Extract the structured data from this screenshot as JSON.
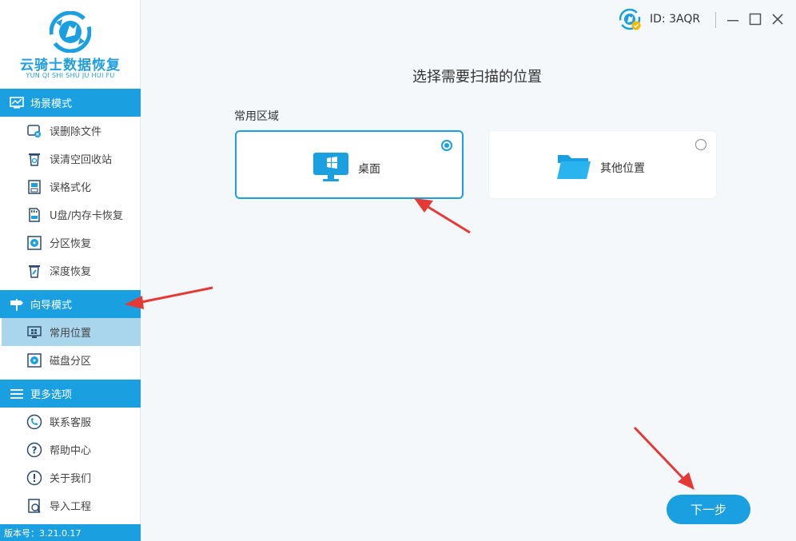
{
  "app": {
    "title": "云骑士数据恢复",
    "subtitle": "YUN QI SHI SHU JU HUI FU",
    "version": "版本号：3.21.0.17",
    "accent": "#1aa0e0"
  },
  "sidebar": {
    "sections": [
      {
        "label": "场景模式",
        "icon": "monitor-chart-icon",
        "items": [
          {
            "label": "误删除文件",
            "icon": "deleted-file-icon"
          },
          {
            "label": "误清空回收站",
            "icon": "recycle-bin-icon"
          },
          {
            "label": "误格式化",
            "icon": "format-icon"
          },
          {
            "label": "U盘/内存卡恢复",
            "icon": "sd-card-icon"
          },
          {
            "label": "分区恢复",
            "icon": "partition-icon"
          },
          {
            "label": "深度恢复",
            "icon": "deep-recovery-icon"
          }
        ]
      },
      {
        "label": "向导模式",
        "icon": "signpost-icon",
        "items": [
          {
            "label": "常用位置",
            "icon": "desktop-icon",
            "active": true
          },
          {
            "label": "磁盘分区",
            "icon": "disk-partition-icon"
          }
        ]
      },
      {
        "label": "更多选项",
        "icon": "menu-icon",
        "items": [
          {
            "label": "联系客服",
            "icon": "phone-icon"
          },
          {
            "label": "帮助中心",
            "icon": "help-icon"
          },
          {
            "label": "关于我们",
            "icon": "info-icon"
          },
          {
            "label": "导入工程",
            "icon": "import-icon"
          }
        ]
      }
    ]
  },
  "titlebar": {
    "user_id": "ID: 3AQR"
  },
  "main": {
    "title": "选择需要扫描的位置",
    "section_label": "常用区域",
    "cards": [
      {
        "label": "桌面",
        "icon": "windows-desktop-icon",
        "selected": true
      },
      {
        "label": "其他位置",
        "icon": "folder-icon",
        "selected": false
      }
    ],
    "next_label": "下一步"
  }
}
